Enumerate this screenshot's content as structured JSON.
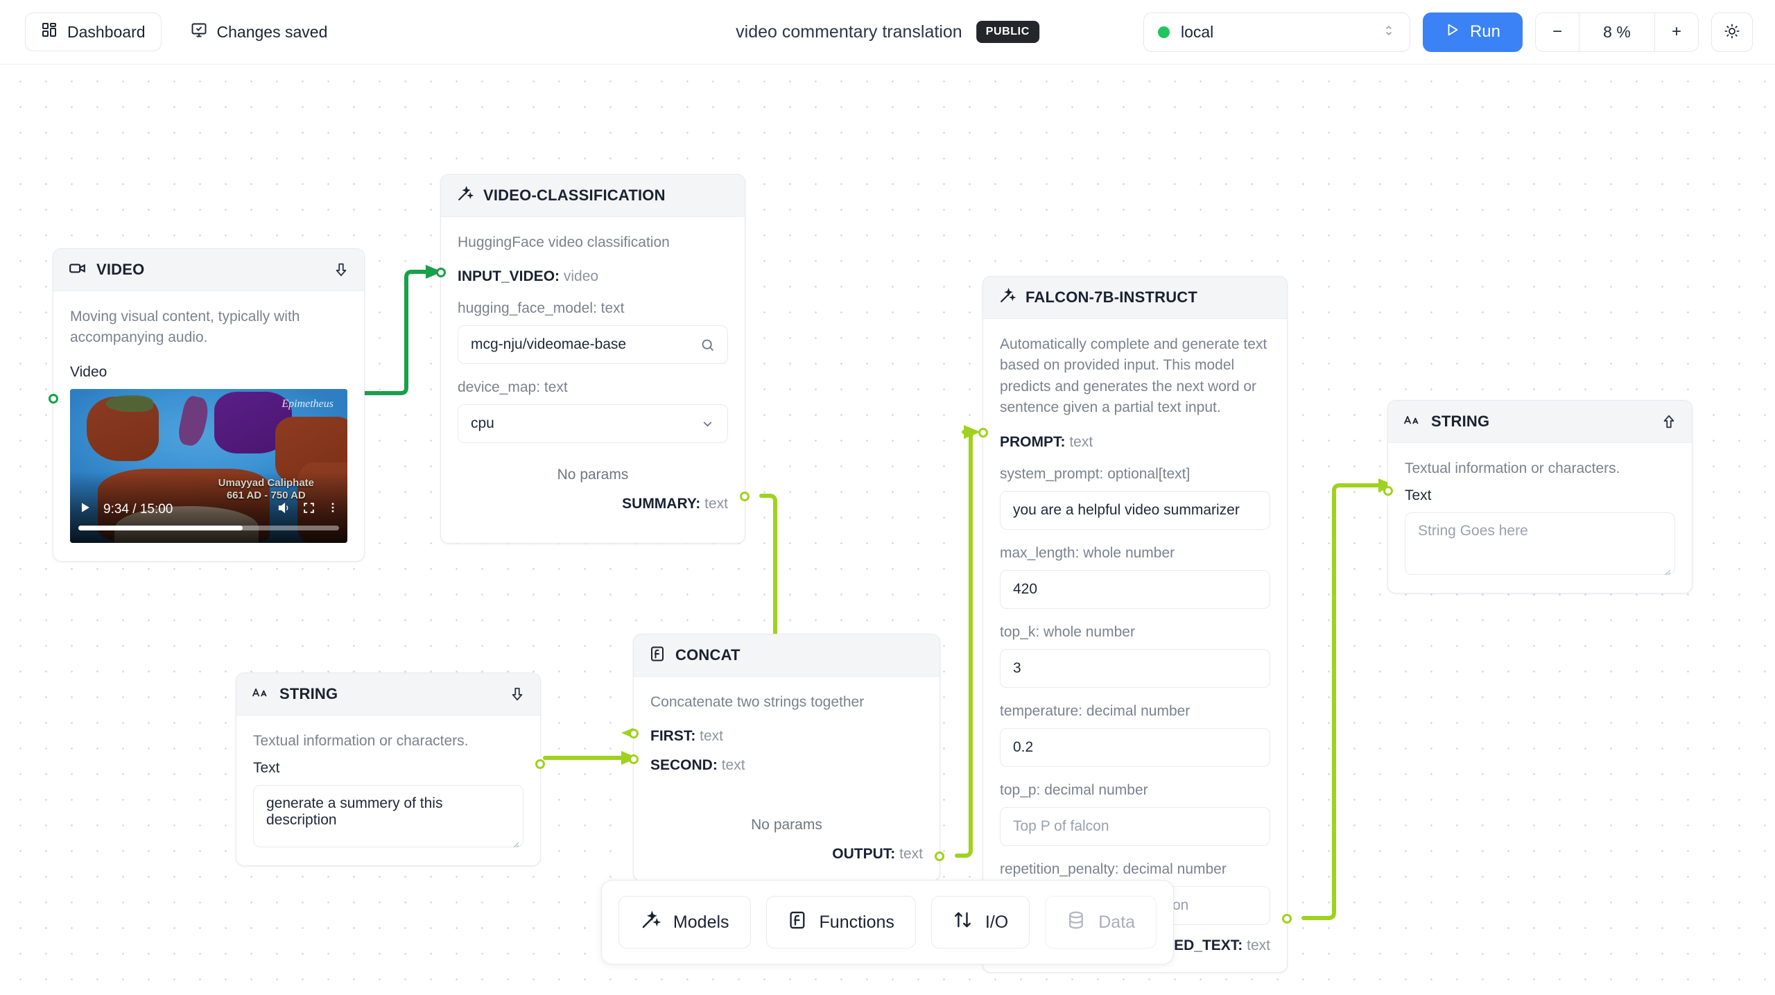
{
  "topbar": {
    "dashboard_label": "Dashboard",
    "dashboard_icon": "grid-icon",
    "changes_saved_label": "Changes saved",
    "changes_saved_icon": "monitor-check-icon",
    "doc_title": "video commentary translation",
    "visibility_badge": "PUBLIC",
    "env_value": "local",
    "env_status_color": "#22c55e",
    "env_caret_icon": "chevron-up-down-icon",
    "run_label": "Run",
    "run_icon": "play-icon",
    "run_color": "#3b82f6",
    "zoom_out_label": "−",
    "zoom_level": "8 %",
    "zoom_in_label": "+",
    "theme_icon": "sun-icon"
  },
  "canvas": {
    "edge_colors": {
      "video": "#18a04a",
      "text": "#9fd21e"
    }
  },
  "nodes": {
    "video": {
      "title": "VIDEO",
      "icon": "video-camera-icon",
      "collapse_icon": "arrow-down-icon",
      "description": "Moving visual content, typically with accompanying audio.",
      "field_label": "Video",
      "player": {
        "time_current": "9:34",
        "time_separator": "/",
        "time_total": "15:00",
        "time_display": "9:34 / 15:00",
        "caption_line1": "Umayyad Caliphate",
        "caption_line2": "661 AD - 750 AD",
        "signature": "Epimetheus",
        "play_icon": "play-icon",
        "volume_icon": "speaker-icon",
        "fullscreen_icon": "fullscreen-icon",
        "more_icon": "kebab-menu-icon",
        "progress_percent": 63
      }
    },
    "video_classification": {
      "title": "VIDEO-CLASSIFICATION",
      "icon": "magic-wand-icon",
      "description": "HuggingFace video classification",
      "input_port": {
        "name": "INPUT_VIDEO:",
        "type": "video"
      },
      "fields": [
        {
          "label": "hugging_face_model: text",
          "value": "mcg-nju/videomae-base",
          "trail_icon": "search-icon",
          "control": "search-input"
        },
        {
          "label": "device_map: text",
          "value": "cpu",
          "trail_icon": "chevron-down-icon",
          "control": "select"
        }
      ],
      "no_params": "No params",
      "output_port": {
        "name": "SUMMARY:",
        "type": "text"
      }
    },
    "string_left": {
      "title": "STRING",
      "icon": "aa-icon",
      "collapse_icon": "arrow-down-icon",
      "description": "Textual information or characters.",
      "field_label": "Text",
      "text_value": "generate a summery of this description",
      "output_port": {
        "name": "",
        "type": ""
      }
    },
    "concat": {
      "title": "CONCAT",
      "icon": "function-icon",
      "description": "Concatenate two strings together",
      "input_ports": [
        {
          "name": "FIRST:",
          "type": "text"
        },
        {
          "name": "SECOND:",
          "type": "text"
        }
      ],
      "no_params": "No params",
      "output_port": {
        "name": "OUTPUT:",
        "type": "text"
      }
    },
    "falcon": {
      "title": "FALCON-7B-INSTRUCT",
      "icon": "magic-wand-icon",
      "description": "Automatically complete and generate text based on provided input. This model predicts and generates the next word or sentence given a partial text input.",
      "input_port": {
        "name": "PROMPT:",
        "type": "text"
      },
      "fields": [
        {
          "label": "system_prompt: optional[text]",
          "value": "you are a helpful video summarizer",
          "is_placeholder": false
        },
        {
          "label": "max_length: whole number",
          "value": "420",
          "is_placeholder": false
        },
        {
          "label": "top_k: whole number",
          "value": "3",
          "is_placeholder": false
        },
        {
          "label": "temperature: decimal number",
          "value": "0.2",
          "is_placeholder": false
        },
        {
          "label": "top_p: decimal number",
          "value": "Top P of falcon",
          "is_placeholder": true
        },
        {
          "label": "repetition_penalty: decimal number",
          "value": "Repetition penalty of falcon",
          "is_placeholder": true
        }
      ],
      "output_port": {
        "name": "GENERATED_TEXT:",
        "type": "text"
      }
    },
    "string_right": {
      "title": "STRING",
      "icon": "aa-icon",
      "collapse_icon": "arrow-up-icon",
      "description": "Textual information or characters.",
      "field_label": "Text",
      "text_placeholder": "String Goes here"
    }
  },
  "bottom_toolbar": {
    "items": [
      {
        "label": "Models",
        "icon": "magic-wand-icon",
        "disabled": false
      },
      {
        "label": "Functions",
        "icon": "function-icon",
        "disabled": false
      },
      {
        "label": "I/O",
        "icon": "arrows-up-down-icon",
        "disabled": false
      },
      {
        "label": "Data",
        "icon": "database-icon",
        "disabled": true
      }
    ]
  }
}
